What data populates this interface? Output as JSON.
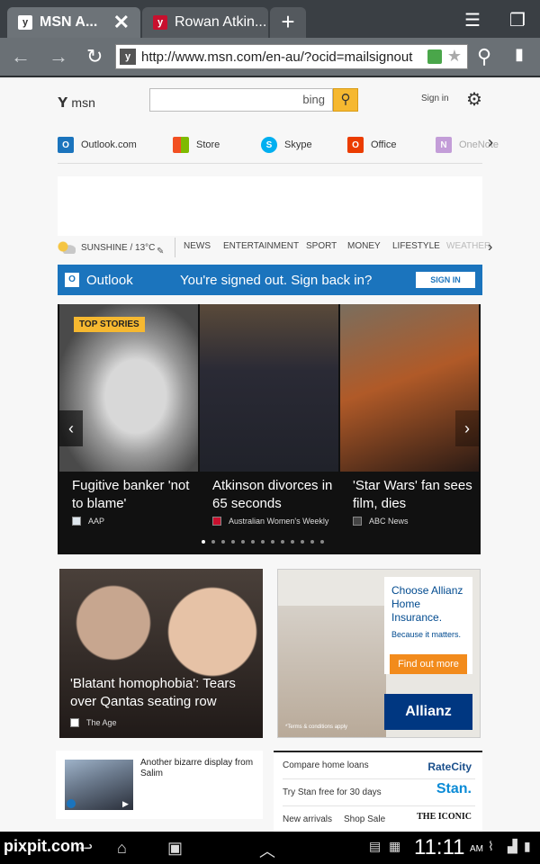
{
  "browser": {
    "tabs": [
      {
        "label": "MSN A...",
        "active": true
      },
      {
        "label": "Rowan Atkin...",
        "active": false
      }
    ],
    "new_tab_symbol": "+",
    "close_symbol": "✕",
    "url": "http://www.msn.com/en-au/?ocid=mailsignout",
    "menu_icon": "menu-icon",
    "windows_icon": "windows-icon"
  },
  "header": {
    "logo_text": "msn",
    "search_placeholder": "bing",
    "signin_label": "Sign in"
  },
  "shortcuts": [
    {
      "label": "Outlook.com",
      "icon": "outlook-icon",
      "color": "#1b74bd"
    },
    {
      "label": "Store",
      "icon": "store-icon",
      "color": "#00a4ef"
    },
    {
      "label": "Skype",
      "icon": "skype-icon",
      "color": "#00aff0"
    },
    {
      "label": "Office",
      "icon": "office-icon",
      "color": "#eb3c00"
    },
    {
      "label": "OneNote",
      "icon": "onenote-icon",
      "color": "#7719aa"
    }
  ],
  "weather": {
    "label": "SUNSHINE / 13°C"
  },
  "nav": [
    "NEWS",
    "ENTERTAINMENT",
    "SPORT",
    "MONEY",
    "LIFESTYLE",
    "WEATHER"
  ],
  "outlook_banner": {
    "title": "Outlook",
    "message": "You're signed out. Sign back in?",
    "button": "SIGN IN"
  },
  "top_stories": {
    "badge": "TOP STORIES",
    "stories": [
      {
        "title": "Fugitive banker 'not to blame'",
        "source": "AAP"
      },
      {
        "title": "Atkinson divorces in 65 seconds",
        "source": "Australian Women's Weekly"
      },
      {
        "title": "'Star Wars' fan sees film, dies",
        "source": "ABC News"
      }
    ],
    "dots_total": 13,
    "active_dot": 0
  },
  "feature_story": {
    "title": "'Blatant homophobia': Tears over Qantas seating row",
    "source": "The Age"
  },
  "allianz_ad": {
    "headline": "Choose Allianz Home Insurance.",
    "tagline": "Because it matters.",
    "cta": "Find out more",
    "brand": "Allianz",
    "terms": "*Terms & conditions apply"
  },
  "salim_card": {
    "text": "Another bizarre display from Salim"
  },
  "promos": [
    {
      "label": "Compare home loans",
      "brand": "RateCity"
    },
    {
      "label": "Try Stan free for 30 days",
      "brand": "Stan."
    },
    {
      "label": "New arrivals",
      "label2": "Shop Sale",
      "brand": "THE ICONIC"
    }
  ],
  "statusbar": {
    "time": "11:11",
    "ampm": "AM",
    "watermark": "pixpit.com"
  },
  "colors": {
    "msn_blue": "#1b74bd",
    "bing_yellow": "#f6b830",
    "chrome_dark": "#3a3f44"
  }
}
